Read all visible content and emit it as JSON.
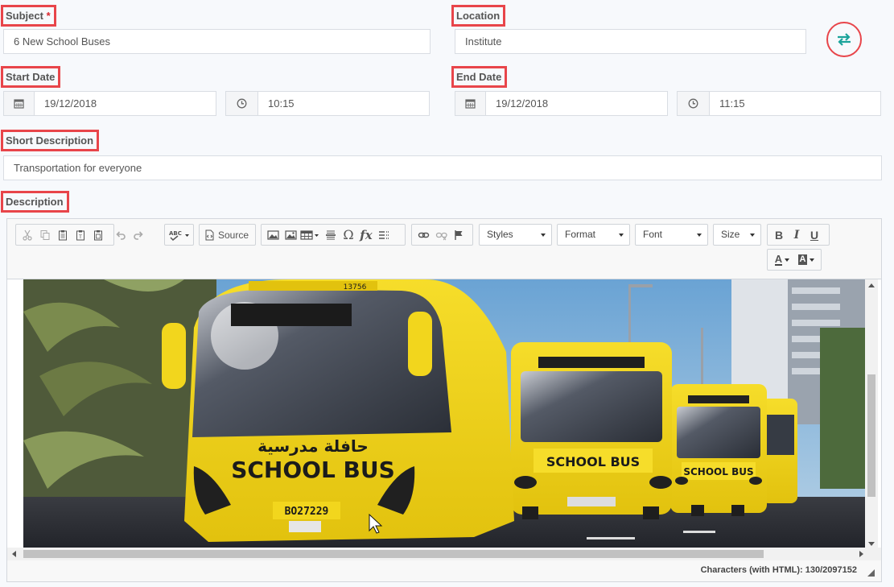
{
  "subject": {
    "label": "Subject",
    "required_mark": "*",
    "value": "6 New School Buses"
  },
  "location": {
    "label": "Location",
    "value": "Institute"
  },
  "start": {
    "label": "Start Date",
    "date": "19/12/2018",
    "time": "10:15"
  },
  "end": {
    "label": "End Date",
    "date": "19/12/2018",
    "time": "11:15"
  },
  "short_description": {
    "label": "Short Description",
    "value": "Transportation for everyone"
  },
  "description": {
    "label": "Description",
    "toolbar": {
      "source_label": "Source",
      "styles_label": "Styles",
      "format_label": "Format",
      "font_label": "Font",
      "size_label": "Size",
      "bold": "B",
      "italic": "I",
      "underline": "U",
      "text_color": "A",
      "bg_color": "A",
      "special_char": "Ω",
      "formula": "fx",
      "spellcheck": "ABC"
    },
    "image": {
      "bus_text_front": "SCHOOL BUS",
      "bus_arabic": "حافلة مدرسية",
      "plate": "BO27229",
      "roof_number": "13756",
      "bus2_text": "SCHOOL BUS",
      "bus3_text": "SCHOOL BUS"
    },
    "footer": "Characters (with HTML): 130/2097152"
  },
  "colors": {
    "highlight": "#e8454a",
    "accent_teal": "#1aa39a",
    "bus_yellow": "#f2d61d"
  }
}
